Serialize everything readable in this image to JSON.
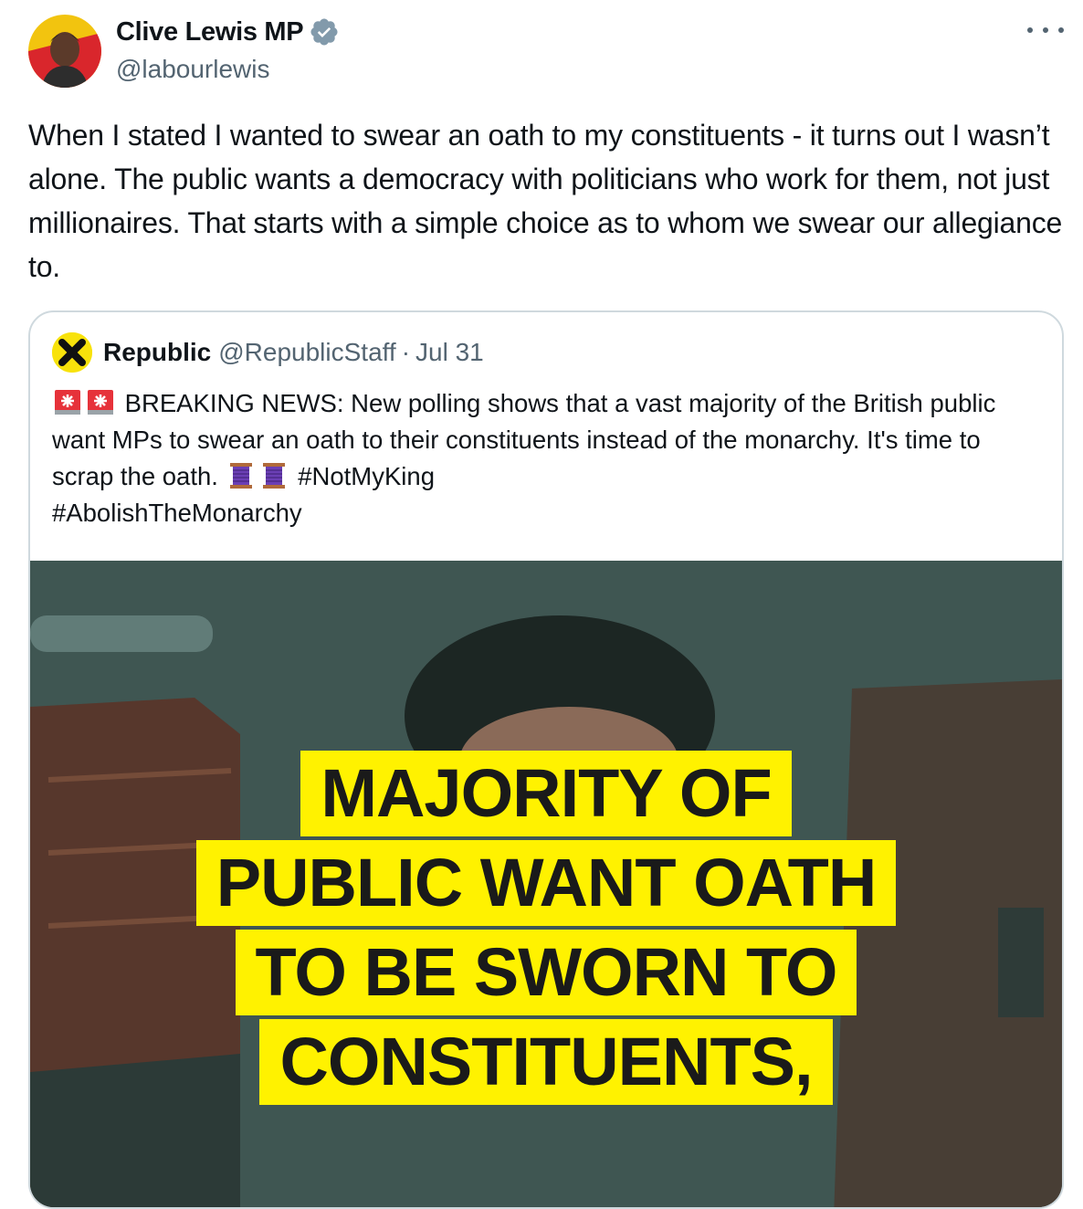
{
  "author": {
    "name": "Clive Lewis MP",
    "handle": "@labourlewis",
    "verified_icon": "verified-badge-icon"
  },
  "tweet": {
    "text": "When I stated I wanted to swear an oath to my constituents - it turns out I wasn’t alone. The public wants a democracy with politicians who work for them, not just millionaires. That starts with a simple choice as to whom we swear our allegiance to."
  },
  "quote": {
    "name": "Republic",
    "handle": "@RepublicStaff",
    "separator": "·",
    "date": "Jul 31",
    "text_part1": "BREAKING NEWS: New polling shows that a vast majority of the British public want MPs to swear an oath to their constituents instead of the monarchy. It's time to scrap the oath.",
    "hashtag1": "#NotMyKing",
    "hashtag2": "#AbolishTheMonarchy",
    "media": {
      "headline_lines": [
        "MAJORITY OF",
        "PUBLIC WANT OATH",
        "TO BE SWORN TO",
        "CONSTITUENTS,"
      ]
    }
  },
  "colors": {
    "text": "#0f1419",
    "secondary": "#536471",
    "border": "#cfd9de",
    "verified": "#829aab",
    "headline_bg": "#fff200"
  }
}
